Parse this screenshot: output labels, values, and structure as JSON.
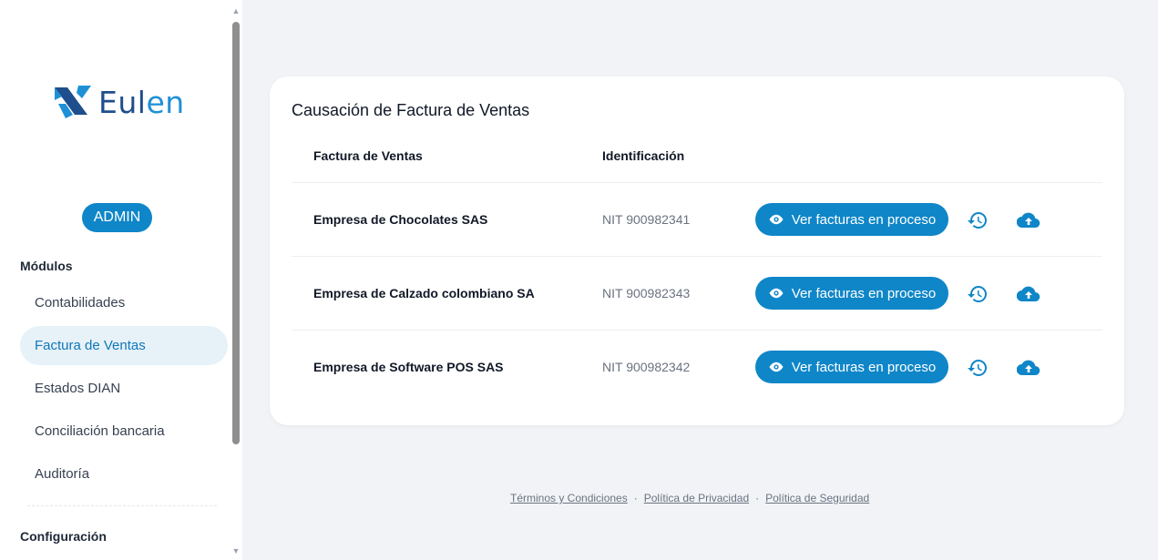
{
  "brand": {
    "name_main": "Eul",
    "name_accent": "en",
    "primary_color": "#1e4e8c",
    "accent_color": "#0f86c8"
  },
  "sidebar": {
    "role_badge": "ADMIN",
    "modules_title": "Módulos",
    "items": [
      {
        "label": "Contabilidades",
        "active": false
      },
      {
        "label": "Factura de Ventas",
        "active": true
      },
      {
        "label": "Estados DIAN",
        "active": false
      },
      {
        "label": "Conciliación bancaria",
        "active": false
      },
      {
        "label": "Auditoría",
        "active": false
      }
    ],
    "config_title": "Configuración"
  },
  "card": {
    "title": "Causación de Factura de Ventas",
    "columns": [
      "Factura de Ventas",
      "Identificación"
    ],
    "rows": [
      {
        "name": "Empresa de Chocolates SAS",
        "id": "NIT 900982341",
        "action": "Ver facturas en proceso"
      },
      {
        "name": "Empresa de Calzado colombiano SA",
        "id": "NIT 900982343",
        "action": "Ver facturas en proceso"
      },
      {
        "name": "Empresa de Software POS SAS",
        "id": "NIT 900982342",
        "action": "Ver facturas en proceso"
      }
    ],
    "icons": [
      "eye-icon",
      "history-icon",
      "cloud-upload-icon"
    ]
  },
  "footer": {
    "links": [
      "Términos y Condiciones",
      "Política de Privacidad",
      "Política de Seguridad"
    ],
    "separator": "·"
  }
}
